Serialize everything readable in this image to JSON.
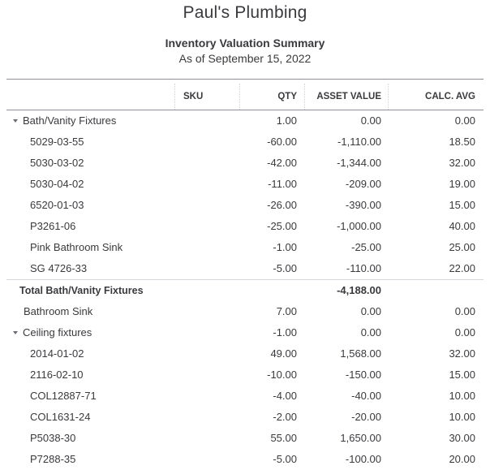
{
  "header": {
    "company": "Paul's Plumbing",
    "title": "Inventory Valuation Summary",
    "date": "As of September 15, 2022"
  },
  "columns": {
    "name": "",
    "sku": "SKU",
    "qty": "QTY",
    "asset_value": "ASSET VALUE",
    "calc_avg": "CALC. AVG"
  },
  "groups": {
    "bath": {
      "label": "Bath/Vanity Fixtures",
      "qty": "1.00",
      "asset_value": "0.00",
      "calc_avg": "0.00",
      "expanded": true,
      "items": [
        {
          "name": "5029-03-55",
          "qty": "-60.00",
          "asset_value": "-1,110.00",
          "calc_avg": "18.50"
        },
        {
          "name": "5030-03-02",
          "qty": "-42.00",
          "asset_value": "-1,344.00",
          "calc_avg": "32.00"
        },
        {
          "name": "5030-04-02",
          "qty": "-11.00",
          "asset_value": "-209.00",
          "calc_avg": "19.00"
        },
        {
          "name": "6520-01-03",
          "qty": "-26.00",
          "asset_value": "-390.00",
          "calc_avg": "15.00"
        },
        {
          "name": "P3261-06",
          "qty": "-25.00",
          "asset_value": "-1,000.00",
          "calc_avg": "40.00"
        },
        {
          "name": "Pink Bathroom Sink",
          "qty": "-1.00",
          "asset_value": "-25.00",
          "calc_avg": "25.00"
        },
        {
          "name": "SG 4726-33",
          "qty": "-5.00",
          "asset_value": "-110.00",
          "calc_avg": "22.00"
        }
      ],
      "total_label": "Total Bath/Vanity Fixtures",
      "total_asset_value": "-4,188.00"
    },
    "bathroom_sink": {
      "label": "Bathroom Sink",
      "qty": "7.00",
      "asset_value": "0.00",
      "calc_avg": "0.00"
    },
    "ceiling": {
      "label": "Ceiling fixtures",
      "qty": "-1.00",
      "asset_value": "0.00",
      "calc_avg": "0.00",
      "expanded": true,
      "items": [
        {
          "name": "2014-01-02",
          "qty": "49.00",
          "asset_value": "1,568.00",
          "calc_avg": "32.00"
        },
        {
          "name": "2116-02-10",
          "qty": "-10.00",
          "asset_value": "-150.00",
          "calc_avg": "15.00"
        },
        {
          "name": "COL12887-71",
          "qty": "-4.00",
          "asset_value": "-40.00",
          "calc_avg": "10.00"
        },
        {
          "name": "COL1631-24",
          "qty": "-2.00",
          "asset_value": "-20.00",
          "calc_avg": "10.00"
        },
        {
          "name": "P5038-30",
          "qty": "55.00",
          "asset_value": "1,650.00",
          "calc_avg": "30.00"
        },
        {
          "name": "P7288-35",
          "qty": "-5.00",
          "asset_value": "-100.00",
          "calc_avg": "20.00"
        }
      ]
    }
  }
}
